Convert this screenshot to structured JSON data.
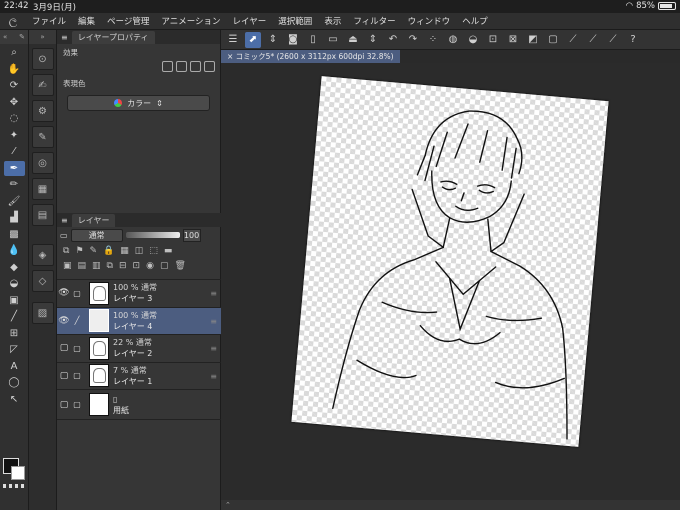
{
  "status": {
    "time": "22:42",
    "date": "3月9日(月)",
    "battery": "85%",
    "battery_level": 0.85
  },
  "menu": [
    "ファイル",
    "編集",
    "ページ管理",
    "アニメーション",
    "レイヤー",
    "選択範囲",
    "表示",
    "フィルター",
    "ウィンドウ",
    "ヘルプ"
  ],
  "layer_property": {
    "title": "レイヤープロパティ",
    "effects_label": "効果",
    "expression_label": "表現色",
    "expression_value": "カラー"
  },
  "layers_panel": {
    "title": "レイヤー",
    "blend_mode": "通常",
    "opacity": "100",
    "layers": [
      {
        "line1": "100 % 通常",
        "line2": "レイヤー 3",
        "visible": true,
        "selected": false
      },
      {
        "line1": "100 % 通常",
        "line2": "レイヤー 4",
        "visible": true,
        "selected": true
      },
      {
        "line1": "22 % 通常",
        "line2": "レイヤー 2",
        "visible": false,
        "selected": false
      },
      {
        "line1": "7 % 通常",
        "line2": "レイヤー 1",
        "visible": false,
        "selected": false
      },
      {
        "line1": "",
        "line2": "用紙",
        "visible": false,
        "selected": false
      }
    ]
  },
  "canvas": {
    "tab_title": "コミック5* (2600 x 3112px 600dpi 32.8%)"
  },
  "icons": {
    "tools": [
      "zoom-icon",
      "hand-icon",
      "rotate-icon",
      "move-icon",
      "lasso-icon",
      "magic-wand-icon",
      "eyedropper-icon",
      "pen-icon",
      "pencil-icon",
      "brush-icon",
      "airbrush-icon",
      "decoration-icon",
      "blend-icon",
      "eraser-icon",
      "fill-icon",
      "gradient-icon",
      "figure-icon",
      "frame-icon",
      "ruler-icon",
      "text-icon",
      "balloon-icon",
      "correct-line-icon"
    ],
    "commands": [
      "menu-icon",
      "transform-icon",
      "layer-icon",
      "new-icon",
      "open-icon",
      "save-icon",
      "undo-icon",
      "redo-icon",
      "deselect-icon",
      "invert-icon",
      "fill-cmd-icon",
      "transform-cmd-icon",
      "clear-icon",
      "clear-outside-icon",
      "snap-icon",
      "ruler-snap-icon",
      "perspective-icon",
      "help-icon"
    ]
  }
}
